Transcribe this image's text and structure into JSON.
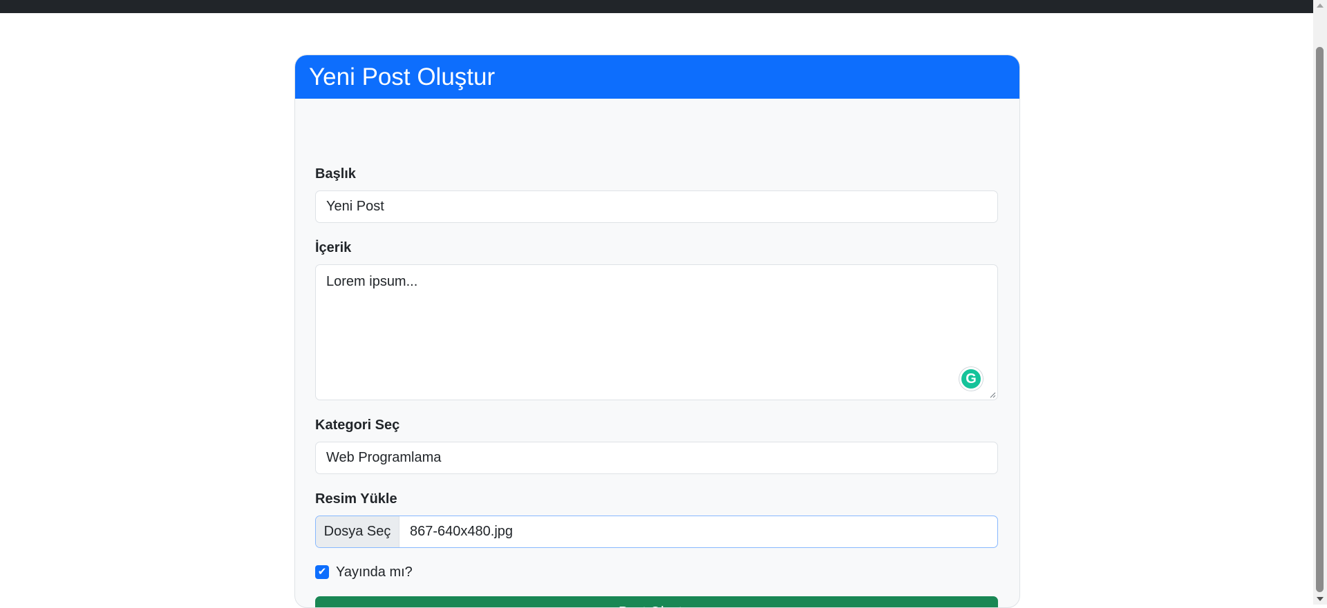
{
  "header": {
    "title": "Yeni Post Oluştur"
  },
  "form": {
    "title_label": "Başlık",
    "title_value": "Yeni Post",
    "content_label": "İçerik",
    "content_value": "Lorem ipsum...",
    "category_label": "Kategori Seç",
    "category_value": "Web Programlama",
    "image_label": "Resim Yükle",
    "file_button": "Dosya Seç",
    "file_name": "867-640x480.jpg",
    "published_label": "Yayında mı?",
    "published_checked": true,
    "submit_label": "Post Oluştur"
  },
  "icons": {
    "grammarly": "grammarly-icon",
    "checkbox": "checkmark-icon"
  },
  "colors": {
    "header": "#0d6efd",
    "submit": "#198754",
    "checkbox": "#0d6efd",
    "grammarly": "#15c39a"
  }
}
